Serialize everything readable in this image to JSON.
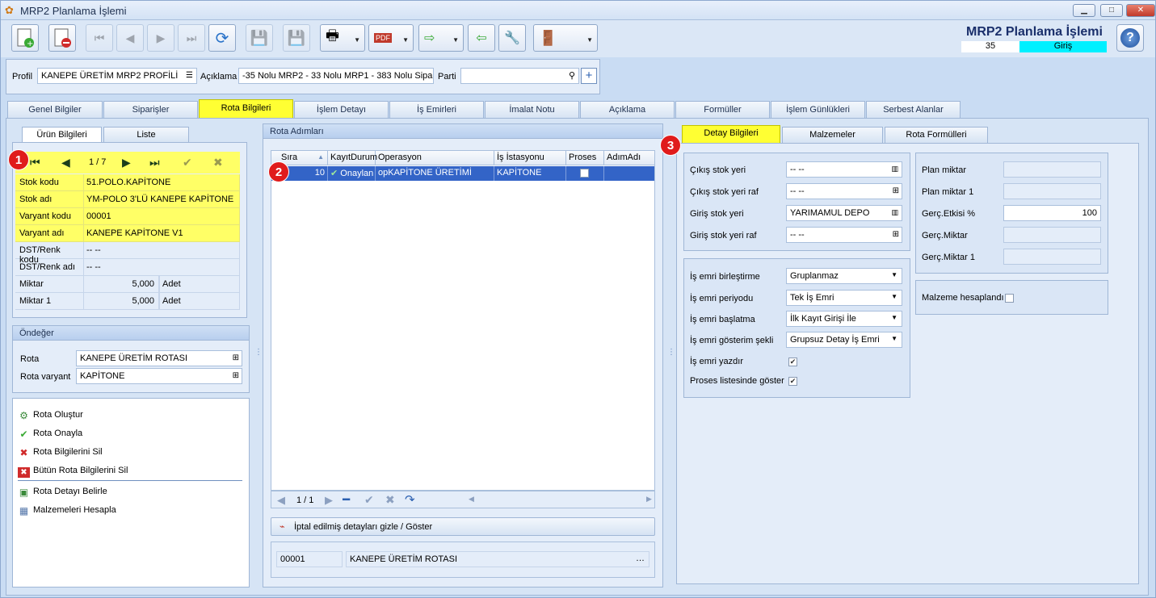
{
  "window": {
    "title": "MRP2 Planlama İşlemi",
    "controls": [
      "▁",
      "□",
      "✕"
    ]
  },
  "header": {
    "title": "MRP2 Planlama İşlemi",
    "number": "35",
    "status": "Giriş",
    "status_color": "#00f0ff"
  },
  "profile_bar": {
    "profil_label": "Profil",
    "profil_value": "KANEPE ÜRETİM MRP2 PROFİLİ",
    "aciklama_label": "Açıklama",
    "aciklama_value": "-35 Nolu MRP2 - 33 Nolu MRP1 - 383 Nolu Sipariş",
    "parti_label": "Parti",
    "parti_value": ""
  },
  "main_tabs": [
    "Genel Bilgiler",
    "Siparişler",
    "Rota Bilgileri",
    "İşlem Detayı",
    "İş Emirleri",
    "İmalat Notu",
    "Açıklama",
    "Formüller",
    "İşlem Günlükleri",
    "Serbest Alanlar"
  ],
  "left": {
    "tabs": [
      "Ürün Bilgileri",
      "Liste"
    ],
    "nav_counter": "1 / 7",
    "badge": "1",
    "rows": [
      {
        "k": "Stok kodu",
        "v": "51.POLO.KAPİTONE"
      },
      {
        "k": "Stok adı",
        "v": "YM-POLO 3'LÜ KANEPE KAPİTONE"
      },
      {
        "k": "Varyant kodu",
        "v": "00001"
      },
      {
        "k": "Varyant adı",
        "v": "KANEPE KAPİTONE V1"
      },
      {
        "k": "DST/Renk kodu",
        "v": "-- --"
      },
      {
        "k": "DST/Renk adı",
        "v": "-- --"
      },
      {
        "k": "Miktar",
        "v": "5,000",
        "u": "Adet"
      },
      {
        "k": "Miktar 1",
        "v": "5,000",
        "u": "Adet"
      }
    ],
    "ondeger_title": "Öndeğer",
    "rota_label": "Rota",
    "rota_value": "KANEPE ÜRETİM ROTASI",
    "rota_varyant_label": "Rota varyant",
    "rota_varyant_value": "KAPİTONE",
    "actions": [
      "Rota Oluştur",
      "Rota Onayla",
      "Rota Bilgilerini Sil",
      "Bütün Rota Bilgilerini Sil",
      "Rota Detayı Belirle",
      "Malzemeleri Hesapla"
    ]
  },
  "middle": {
    "title": "Rota Adımları",
    "badge": "2",
    "columns": [
      "Sıra",
      "KayıtDurum",
      "Operasyon",
      "İş İstasyonu",
      "Proses",
      "AdımAdı"
    ],
    "row": {
      "sira": "10",
      "durum": "Onaylan",
      "operasyon": "opKAPİTONE ÜRETİMİ",
      "istasyon": "KAPİTONE",
      "adim": ""
    },
    "pager": "1 / 1",
    "cancel_toggle": "İptal edilmiş detayları gizle / Göster",
    "footer_code": "00001",
    "footer_name": "KANEPE ÜRETİM ROTASI"
  },
  "right": {
    "tabs": [
      "Detay Bilgileri",
      "Malzemeler",
      "Rota Formülleri"
    ],
    "badge": "3",
    "stock": [
      {
        "k": "Çıkış stok yeri",
        "v": "-- --"
      },
      {
        "k": "Çıkış stok yeri raf",
        "v": "-- --"
      },
      {
        "k": "Giriş stok yeri",
        "v": "YARIMAMUL DEPO"
      },
      {
        "k": "Giriş stok yeri raf",
        "v": "-- --"
      }
    ],
    "workorder": [
      {
        "k": "İş emri birleştirme",
        "v": "Gruplanmaz"
      },
      {
        "k": "İş emri periyodu",
        "v": "Tek İş Emri"
      },
      {
        "k": "İş emri başlatma",
        "v": "İlk Kayıt Girişi İle"
      },
      {
        "k": "İş emri gösterim şekli",
        "v": "Grupsuz Detay İş Emri"
      }
    ],
    "yazdir_label": "İş emri yazdır",
    "proses_label": "Proses listesinde göster",
    "plan": [
      {
        "k": "Plan miktar",
        "v": ""
      },
      {
        "k": "Plan miktar 1",
        "v": ""
      },
      {
        "k": "Gerç.Etkisi %",
        "v": "100"
      },
      {
        "k": "Gerç.Miktar",
        "v": ""
      },
      {
        "k": "Gerç.Miktar 1",
        "v": ""
      }
    ],
    "malzeme_label": "Malzeme hesaplandı"
  }
}
